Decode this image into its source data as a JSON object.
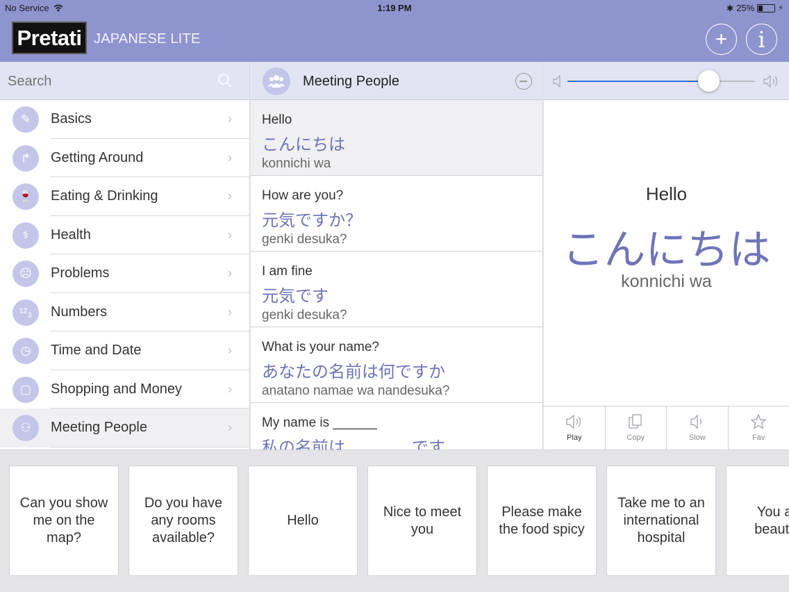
{
  "status_bar": {
    "carrier": "No Service",
    "time": "1:19 PM",
    "battery": "25%"
  },
  "header": {
    "logo": "Pretati",
    "subtitle": "JAPANESE LITE",
    "add_symbol": "+",
    "info_symbol": "i"
  },
  "search": {
    "placeholder": "Search"
  },
  "categories": [
    {
      "label": "Basics",
      "icon": "pencil-icon",
      "glyph": "✎"
    },
    {
      "label": "Getting Around",
      "icon": "turn-arrow-icon",
      "glyph": "↱"
    },
    {
      "label": "Eating & Drinking",
      "icon": "glass-icon",
      "glyph": "🍷"
    },
    {
      "label": "Health",
      "icon": "stethoscope-icon",
      "glyph": "⚕"
    },
    {
      "label": "Problems",
      "icon": "sad-face-icon",
      "glyph": "☹"
    },
    {
      "label": "Numbers",
      "icon": "numbers-icon",
      "glyph": "¹²₃"
    },
    {
      "label": "Time and Date",
      "icon": "clock-calendar-icon",
      "glyph": "◷"
    },
    {
      "label": "Shopping and Money",
      "icon": "shopping-bag-icon",
      "glyph": "▢"
    },
    {
      "label": "Meeting People",
      "icon": "people-icon",
      "glyph": "⚇",
      "active": true
    }
  ],
  "phrase_list": {
    "title": "Meeting People",
    "items": [
      {
        "en": "Hello",
        "jp": "こんにちは",
        "ro": "konnichi wa",
        "active": true
      },
      {
        "en": "How are you?",
        "jp": "元気ですか？",
        "ro": "genki desuka?"
      },
      {
        "en": "I am fine",
        "jp": "元気です",
        "ro": "genki desuka?"
      },
      {
        "en": "What is your name?",
        "jp": "あなたの名前は何ですか",
        "ro": "anatano namae wa nandesuka?"
      },
      {
        "en": "My name is ______",
        "jp": "私の名前は＿＿＿＿です",
        "ro": ""
      }
    ]
  },
  "detail": {
    "volume": 0.75,
    "en": "Hello",
    "jp": "こんにちは",
    "ro": "konnichi wa",
    "actions": [
      {
        "label": "Play",
        "icon": "speaker-icon",
        "active": true
      },
      {
        "label": "Copy",
        "icon": "copy-icon"
      },
      {
        "label": "Slow",
        "icon": "speaker-slow-icon"
      },
      {
        "label": "Fav",
        "icon": "star-icon"
      }
    ]
  },
  "tiles": [
    "Can you show me on the map?",
    "Do you have any rooms available?",
    "Hello",
    "Nice to meet you",
    "Please make the food spicy",
    "Take me to an international hospital",
    "You are beautiful"
  ],
  "colors": {
    "header": "#8e94cd",
    "accent_text": "#6e74b8",
    "panel_head": "#e3e4f3",
    "slider": "#2f6fd6"
  }
}
